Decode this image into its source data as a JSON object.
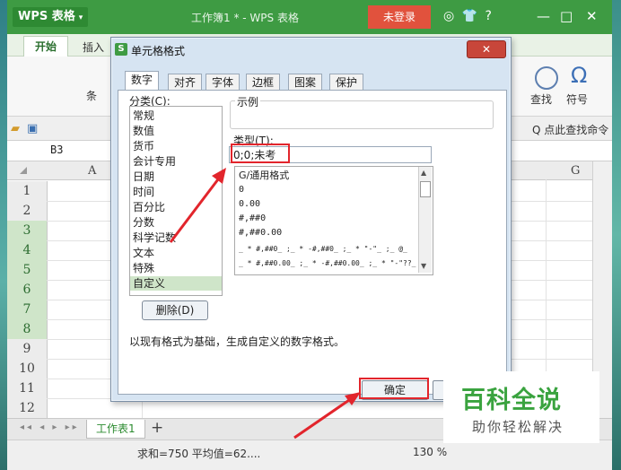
{
  "app": {
    "logo": "WPS 表格",
    "doc_title": "工作簿1 * - WPS 表格",
    "login": "未登录",
    "toolbar_glyphs": "◎ 👕 ?",
    "win_min": "—",
    "win_max": "□",
    "win_close": "✕"
  },
  "tabs": {
    "start": "开始",
    "insert": "插入"
  },
  "ribbon": {
    "find": "查找",
    "symbol": "符号",
    "omega": "Ω",
    "find_cmd": "Q 点此查找命令",
    "cond_fmt_partial": "条"
  },
  "formula_bar": {
    "name_box": "B3"
  },
  "grid": {
    "columns": [
      "A",
      "G"
    ],
    "rows": [
      "1",
      "2",
      "3",
      "4",
      "5",
      "6",
      "7",
      "8",
      "9",
      "10",
      "11",
      "12"
    ]
  },
  "sheet_tabs": {
    "sheet1": "工作表1",
    "add": "+"
  },
  "status": {
    "summary": "求和=750  平均值=62....",
    "zoom": "130 %"
  },
  "dialog": {
    "title": "单元格格式",
    "close": "✕",
    "tabs": [
      "数字",
      "对齐",
      "字体",
      "边框",
      "图案",
      "保护"
    ],
    "category_label": "分类(C):",
    "categories": [
      "常规",
      "数值",
      "货币",
      "会计专用",
      "日期",
      "时间",
      "百分比",
      "分数",
      "科学记数",
      "文本",
      "特殊",
      "自定义"
    ],
    "selected_category": "自定义",
    "sample_label": "示例",
    "type_label": "类型(T):",
    "type_value": "0;0;未考",
    "formats": [
      "G/通用格式",
      "0",
      "0.00",
      "#,##0",
      "#,##0.00",
      "_ * #,##0_ ;_ * -#,##0_ ;_ * \"-\"_ ;_ @_ ",
      "_ * #,##0.00_ ;_ * -#,##0.00_ ;_ * \"-\"??_ ;_ @_ "
    ],
    "delete": "删除(D)",
    "hint": "以现有格式为基础，生成自定义的数字格式。",
    "ok": "确定"
  },
  "watermark": {
    "main": "百科全说",
    "sub": "助你轻松解决"
  },
  "colors": {
    "brand_green": "#3e9b43",
    "highlight_red": "#e2252c",
    "login_red": "#e1523d"
  }
}
